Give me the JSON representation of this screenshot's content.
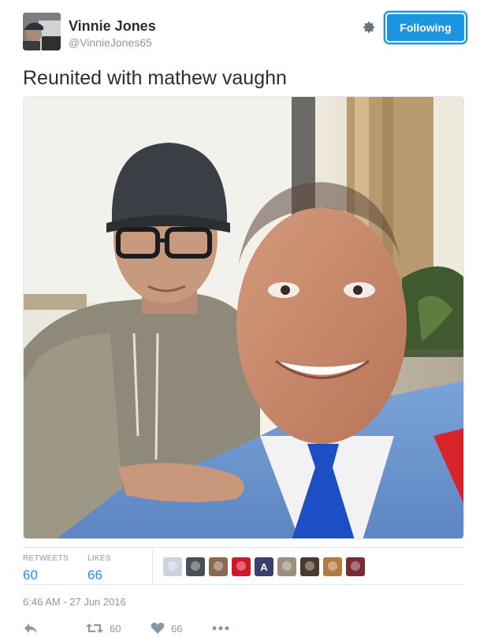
{
  "user": {
    "display_name": "Vinnie Jones",
    "handle": "@VinnieJones65"
  },
  "header": {
    "follow_label": "Following",
    "settings_icon": "gear-icon"
  },
  "tweet": {
    "text": "Reunited with mathew vaughn",
    "photo_icon": "photo-image"
  },
  "stats": {
    "retweets_label": "RETWEETS",
    "retweets_value": "60",
    "likes_label": "LIKES",
    "likes_value": "66",
    "likers": [
      {
        "name": "liker-avatar-1",
        "color": "#c9d4de"
      },
      {
        "name": "liker-avatar-2",
        "color": "#4a4f55"
      },
      {
        "name": "liker-avatar-3",
        "color": "#8a6a55"
      },
      {
        "name": "liker-avatar-4",
        "color": "#d0182c"
      },
      {
        "name": "liker-avatar-5",
        "color": "#3a3f6b",
        "text": "A"
      },
      {
        "name": "liker-avatar-6",
        "color": "#9c8f82"
      },
      {
        "name": "liker-avatar-7",
        "color": "#4d3a2e"
      },
      {
        "name": "liker-avatar-8",
        "color": "#b57a44"
      },
      {
        "name": "liker-avatar-9",
        "color": "#7a2a34"
      }
    ]
  },
  "timestamp": "6:46 AM - 27 Jun 2016",
  "actions": {
    "reply_icon": "reply-icon",
    "retweet_icon": "retweet-icon",
    "retweet_count": "60",
    "like_icon": "heart-icon",
    "like_count": "66",
    "more_icon": "more-icon"
  },
  "colors": {
    "accent": "#1b95e0",
    "muted": "#8899a6",
    "text": "#292f33"
  }
}
